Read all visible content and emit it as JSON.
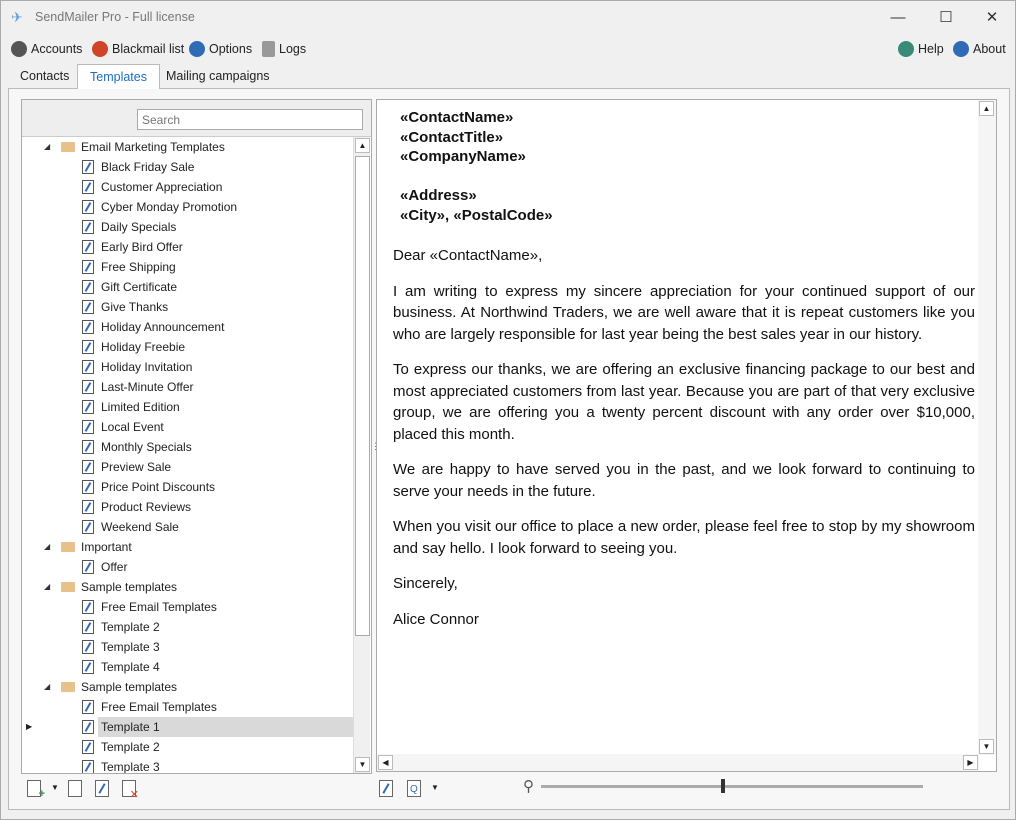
{
  "window": {
    "title": "SendMailer Pro - Full license"
  },
  "toolbar": {
    "accounts": "Accounts",
    "blackmail": "Blackmail list",
    "options": "Options",
    "logs": "Logs",
    "help": "Help",
    "about": "About"
  },
  "tabs": [
    {
      "label": "Contacts"
    },
    {
      "label": "Templates"
    },
    {
      "label": "Mailing campaigns"
    }
  ],
  "search": {
    "placeholder": "Search"
  },
  "tree": [
    {
      "type": "folder",
      "label": "Email Marketing Templates"
    },
    {
      "type": "item",
      "label": "Black Friday Sale"
    },
    {
      "type": "item",
      "label": "Customer Appreciation"
    },
    {
      "type": "item",
      "label": "Cyber Monday Promotion"
    },
    {
      "type": "item",
      "label": "Daily Specials"
    },
    {
      "type": "item",
      "label": "Early Bird Offer"
    },
    {
      "type": "item",
      "label": "Free Shipping"
    },
    {
      "type": "item",
      "label": "Gift Certificate"
    },
    {
      "type": "item",
      "label": "Give Thanks"
    },
    {
      "type": "item",
      "label": "Holiday Announcement"
    },
    {
      "type": "item",
      "label": "Holiday Freebie"
    },
    {
      "type": "item",
      "label": "Holiday Invitation"
    },
    {
      "type": "item",
      "label": "Last-Minute Offer"
    },
    {
      "type": "item",
      "label": "Limited Edition"
    },
    {
      "type": "item",
      "label": "Local Event"
    },
    {
      "type": "item",
      "label": "Monthly Specials"
    },
    {
      "type": "item",
      "label": "Preview Sale"
    },
    {
      "type": "item",
      "label": "Price Point Discounts"
    },
    {
      "type": "item",
      "label": "Product Reviews"
    },
    {
      "type": "item",
      "label": "Weekend Sale"
    },
    {
      "type": "folder",
      "label": "Important"
    },
    {
      "type": "item",
      "label": "Offer"
    },
    {
      "type": "folder",
      "label": "Sample templates"
    },
    {
      "type": "item",
      "label": "Free Email Templates"
    },
    {
      "type": "item",
      "label": "Template 2"
    },
    {
      "type": "item",
      "label": "Template 3"
    },
    {
      "type": "item",
      "label": "Template 4"
    },
    {
      "type": "folder",
      "label": "Sample templates"
    },
    {
      "type": "item",
      "label": "Free Email Templates"
    },
    {
      "type": "item",
      "label": "Template 1",
      "selected": true
    },
    {
      "type": "item",
      "label": "Template 2"
    },
    {
      "type": "item",
      "label": "Template 3"
    }
  ],
  "document": {
    "address": [
      "«ContactName»",
      "«ContactTitle»",
      "«CompanyName»",
      "",
      "«Address»",
      "«City», «PostalCode»"
    ],
    "paragraphs": [
      "Dear «ContactName»,",
      "I am writing to express my sincere appreciation for your continued support of our business. At Northwind Traders, we are well aware that it is repeat customers like you who are largely responsible for last year being the best sales year in our history.",
      "To express our thanks, we are offering an exclusive financing package to our best and most appreciated customers from last year. Because you are part of that very exclusive group, we are offering you a twenty percent discount with any order over $10,000, placed this month.",
      "We are happy to have served you in the past, and we look forward to continuing to serve your needs in the future.",
      "When you visit our office to place a new order, please feel free to stop by my showroom and say hello. I look forward to seeing you.",
      "Sincerely,",
      "Alice Connor"
    ]
  },
  "zoom_slider": {
    "value": 0.5
  },
  "colors": {
    "accent": "#1a6fc0",
    "blackmail": "#d0442a",
    "options": "#2f6cb5",
    "help": "#3a8a7a"
  }
}
